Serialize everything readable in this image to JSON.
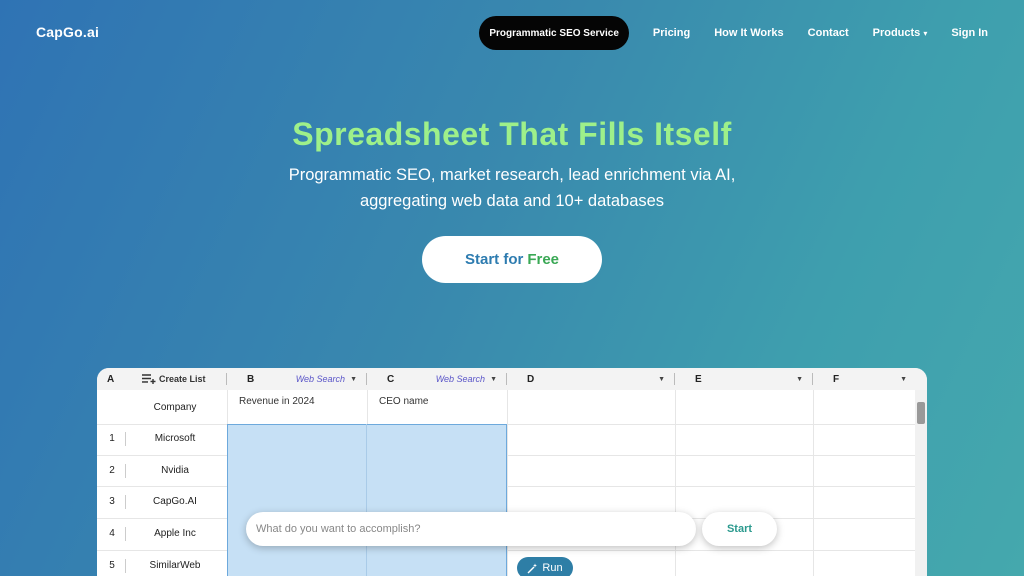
{
  "brand": {
    "logo": "CapGo.ai"
  },
  "nav": {
    "items": [
      {
        "label": "Programmatic SEO Service"
      },
      {
        "label": "Pricing"
      },
      {
        "label": "How It Works"
      },
      {
        "label": "Contact"
      },
      {
        "label": "Products"
      },
      {
        "label": "Sign In"
      }
    ],
    "caret": "▾"
  },
  "hero": {
    "title": "Spreadsheet That Fills Itself",
    "subtitle_line1": "Programmatic SEO, market research, lead enrichment via AI,",
    "subtitle_line2": "aggregating web data and 10+ databases",
    "cta_part1": "Start for",
    "cta_part2": "Free"
  },
  "sheet": {
    "create_list": "Create List",
    "columns": [
      {
        "letter": "A"
      },
      {
        "letter": "B",
        "source": "Web Search"
      },
      {
        "letter": "C",
        "source": "Web Search"
      },
      {
        "letter": "D"
      },
      {
        "letter": "E"
      },
      {
        "letter": "F"
      }
    ],
    "dropdown": "▼",
    "headers": {
      "a": "Company",
      "b": "Revenue in 2024",
      "c": "CEO name"
    },
    "rows": [
      {
        "num": "1",
        "company": "Microsoft"
      },
      {
        "num": "2",
        "company": "Nvidia"
      },
      {
        "num": "3",
        "company": "CapGo.AI"
      },
      {
        "num": "4",
        "company": "Apple Inc"
      },
      {
        "num": "5",
        "company": "SimilarWeb"
      }
    ]
  },
  "prompt": {
    "placeholder": "What do you want to accomplish?",
    "start_label": "Start",
    "run_label": "Run"
  },
  "colors": {
    "accent_green": "#9ef08a",
    "nav_pill": "#050505",
    "selection": "#c6e0f5",
    "run_button": "#2e7ea6",
    "start_text": "#2b9a8e"
  }
}
